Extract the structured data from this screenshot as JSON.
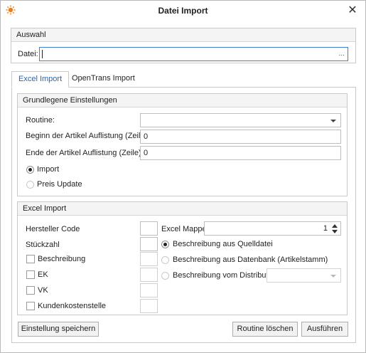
{
  "window": {
    "title": "Datei Import",
    "icon": "app-sun-icon",
    "close_icon": "close-icon",
    "accent_color": "#2266b5",
    "icon_color": "#f07c14"
  },
  "auswahl": {
    "header": "Auswahl",
    "datei_label": "Datei:",
    "datei_value": "",
    "browse_label": "..."
  },
  "tabs": [
    {
      "label": "Excel Import",
      "active": true
    },
    {
      "label": "OpenTrans Import",
      "active": false
    }
  ],
  "grundlegende": {
    "header": "Grundlegene Einstellungen",
    "routine_label": "Routine:",
    "routine_value": "",
    "beginn_label": "Beginn der Artikel Auflistung (Zeile)",
    "beginn_value": "0",
    "ende_label": "Ende der Artikel Auflistung (Zeile)",
    "ende_value": "0",
    "radio_import": "Import",
    "radio_preis": "Preis Update",
    "selected_mode": "Import"
  },
  "excel_import": {
    "header": "Excel Import",
    "hersteller_label": "Hersteller Code",
    "stueckzahl_label": "Stückzahl",
    "beschreibung_label": "Beschreibung",
    "ek_label": "EK",
    "vk_label": "VK",
    "kunden_label": "Kundenkostenstelle",
    "mappe_label": "Excel Mappe",
    "mappe_value": "1",
    "opt_quelldatei": "Beschreibung aus Quelldatei",
    "opt_datenbank": "Beschreibung aus Datenbank (Artikelstamm)",
    "opt_distributor": "Beschreibung vom Distributor",
    "selected_beschreibung": "Beschreibung aus Quelldatei"
  },
  "buttons": {
    "save": "Einstellung speichern",
    "delete": "Routine löschen",
    "run": "Ausführen"
  }
}
